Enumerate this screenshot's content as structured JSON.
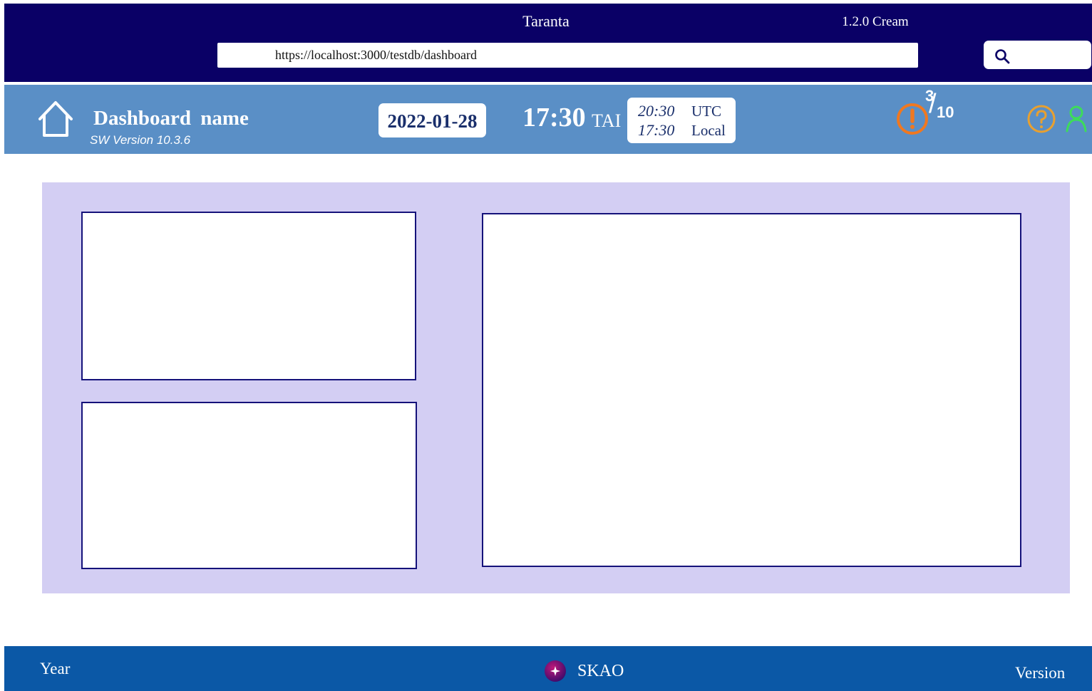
{
  "browser": {
    "app_title": "Taranta",
    "app_version": "1.2.0 Cream",
    "url": "https://localhost:3000/testdb/dashboard",
    "search_icon": "search-icon"
  },
  "header": {
    "home_icon": "home-icon",
    "dashboard_name": "Dashboard name",
    "sw_version": "SW Version 10.3.6",
    "date": "2022-01-28",
    "tai_time": "17:30",
    "tai_label": "TAI",
    "utc_time": "20:30",
    "utc_label": "UTC",
    "local_time": "17:30",
    "local_label": "Local",
    "alarm_count": "3",
    "alarm_total": "10",
    "colors": {
      "top_bar": "#0a0066",
      "header_bar": "#5a8fc6",
      "alarm": "#f07820",
      "help": "#e8a030",
      "user": "#3ddc5a"
    }
  },
  "main": {
    "panel_color": "#d3cef3",
    "widget_border": "#15127a"
  },
  "footer": {
    "year_label": "Year",
    "brand": "SKAO",
    "version_label": "Version",
    "color": "#0b58a6"
  }
}
